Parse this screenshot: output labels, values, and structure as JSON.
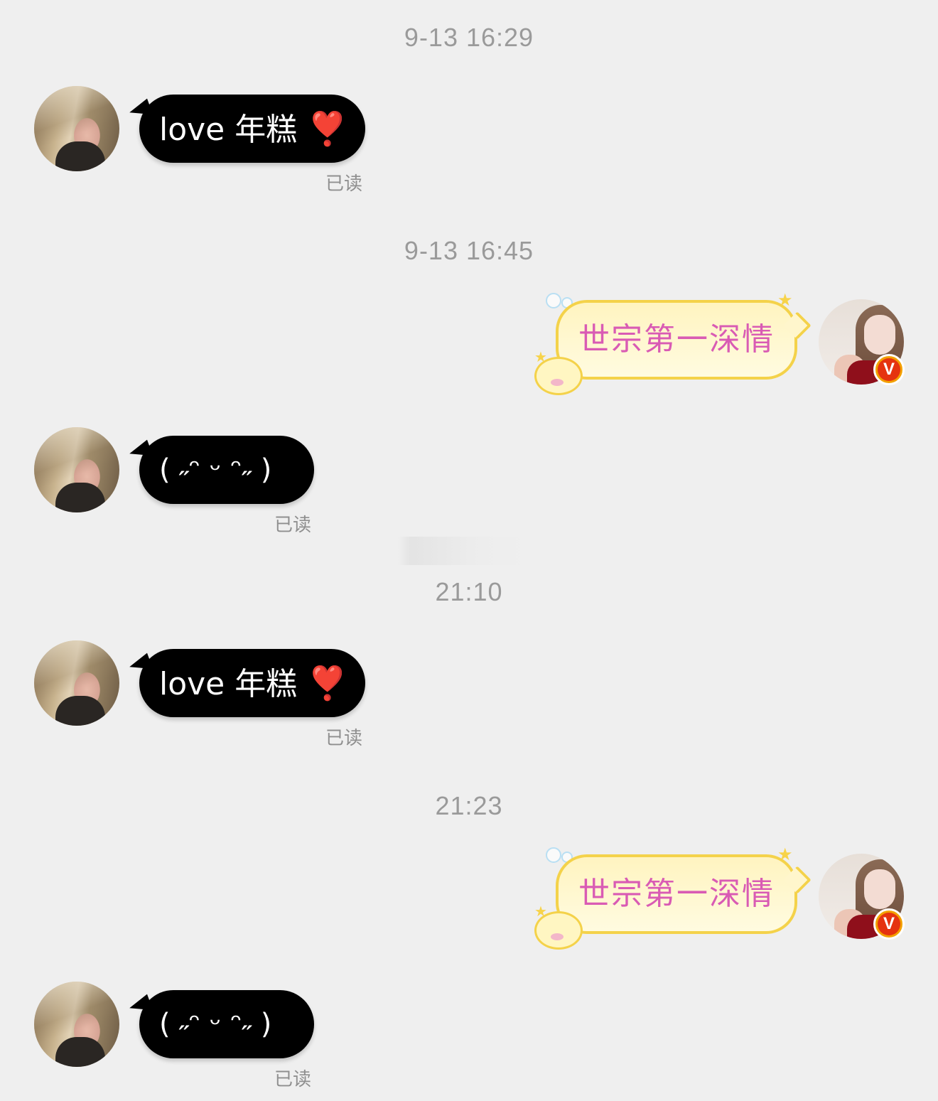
{
  "timestamps": [
    "9-13 16:29",
    "9-13 16:45",
    "21:10",
    "21:23"
  ],
  "messages": {
    "m1": {
      "text": "love 年糕",
      "emoji": "❣️",
      "status": "已读"
    },
    "m2": {
      "text": "世宗第一深情"
    },
    "m3": {
      "text": "ᥫ᭡ᡣ𐭩 ͡ ᥫ᭡",
      "display": "( ˶ᵔ ᵕ ᵔ˶ )",
      "status": "已读"
    },
    "m4": {
      "text": "love 年糕",
      "emoji": "❣️",
      "status": "已读"
    },
    "m5": {
      "text": "世宗第一深情"
    },
    "m6": {
      "display": "( ˶ᵔ ᵕ ᵔ˶ )",
      "status": "已读"
    }
  },
  "badge": {
    "label": "V"
  },
  "colors": {
    "background": "#efefef",
    "bubble_black": "#000000",
    "bubble_yellow": "#fff4c0",
    "bubble_yellow_border": "#f4d24a",
    "bubble_yellow_text": "#d95bb4",
    "timestamp": "#9a9a9a",
    "verified_badge": "#f3a000"
  }
}
